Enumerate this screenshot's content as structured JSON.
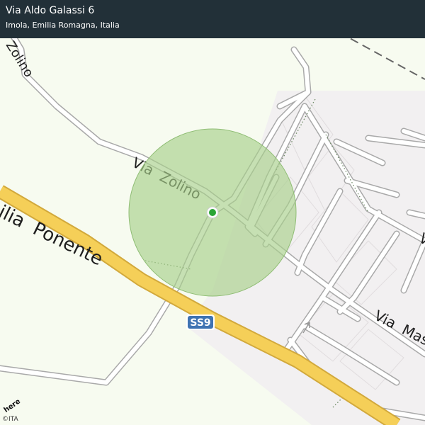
{
  "header": {
    "title": "Via Aldo Galassi 6",
    "subtitle": "Imola, Emilia Romagna, Italia"
  },
  "map": {
    "road_labels": {
      "via_zolino": "Via  Zolino",
      "emilia_ponente": "ilia  Ponente",
      "via_mas": "Via  Mas",
      "zolino_top": "Zolino",
      "via_v": "V"
    },
    "shield": {
      "label": "SS9",
      "color": "#3f73b2"
    },
    "accuracy_circle_color": "#a8cf8a",
    "location_dot_color": "#2aa535",
    "highway_color": "#f5cf58",
    "background_color": "#f7fbf0",
    "urban_area_color": "#f2f0f1"
  },
  "footer": {
    "attribution": "©ITA",
    "logo": "here"
  }
}
